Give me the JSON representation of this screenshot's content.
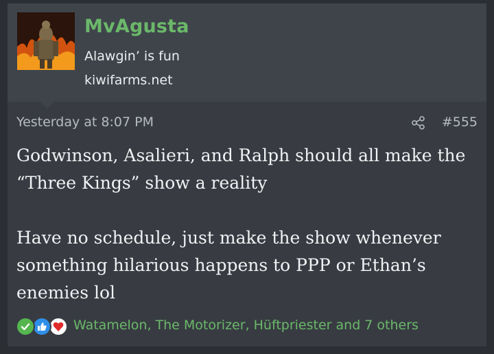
{
  "user": {
    "name": "MvAgusta",
    "title": "Alawgin’ is fun",
    "site": "kiwifarms.net"
  },
  "post": {
    "timestamp": "Yesterday at 8:07 PM",
    "number": "#555",
    "paragraphs": [
      [
        "Godwinson, Asalieri, and Ralph should all make the",
        "“Three Kings” show a reality"
      ],
      [
        "Have no schedule, just make the show whenever",
        "something hilarious happens to PPP or Ethan’s",
        "enemies lol"
      ]
    ]
  },
  "reactions": {
    "icons": [
      "check-icon",
      "thumbs-up-icon",
      "heart-icon"
    ],
    "summary": "Watamelon, The Motorizer, Hüftpriester and 7 others"
  },
  "colors": {
    "accent_green": "#6bb86a",
    "background": "#383c42",
    "header": "#3f444b"
  }
}
